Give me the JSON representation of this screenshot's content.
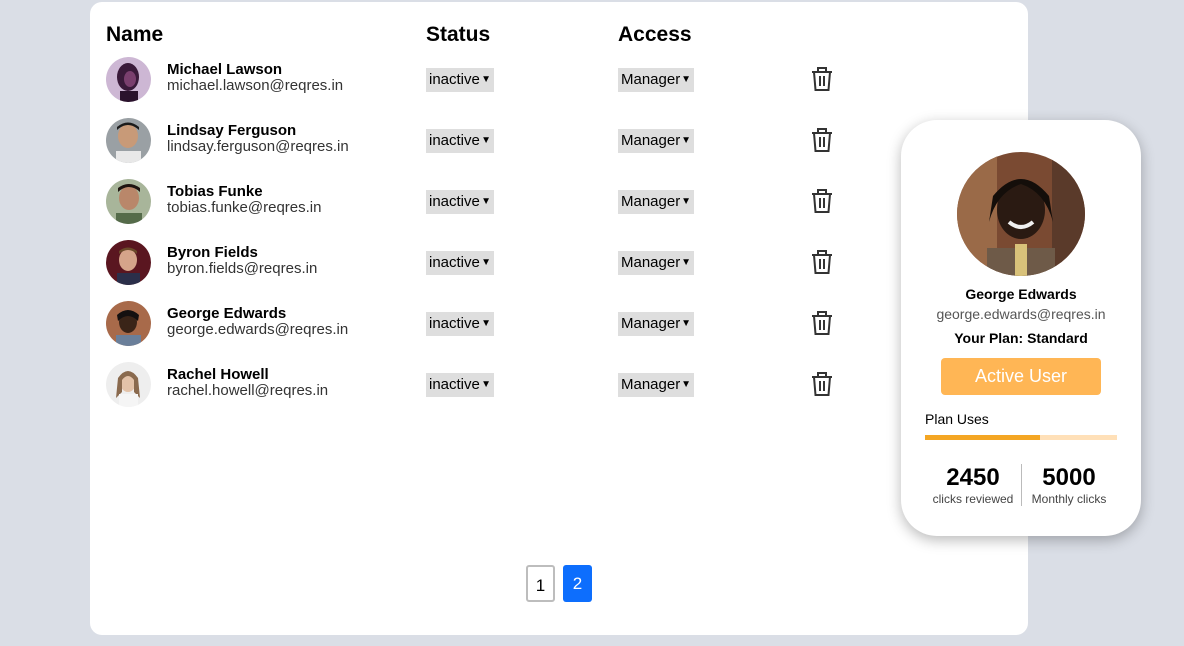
{
  "table": {
    "headers": {
      "name": "Name",
      "status": "Status",
      "access": "Access"
    },
    "rows": [
      {
        "name": "Michael Lawson",
        "email": "michael.lawson@reqres.in",
        "status": "inactive",
        "access": "Manager"
      },
      {
        "name": "Lindsay Ferguson",
        "email": "lindsay.ferguson@reqres.in",
        "status": "inactive",
        "access": "Manager"
      },
      {
        "name": "Tobias Funke",
        "email": "tobias.funke@reqres.in",
        "status": "inactive",
        "access": "Manager"
      },
      {
        "name": "Byron Fields",
        "email": "byron.fields@reqres.in",
        "status": "inactive",
        "access": "Manager"
      },
      {
        "name": "George Edwards",
        "email": "george.edwards@reqres.in",
        "status": "inactive",
        "access": "Manager"
      },
      {
        "name": "Rachel Howell",
        "email": "rachel.howell@reqres.in",
        "status": "inactive",
        "access": "Manager"
      }
    ]
  },
  "pagination": {
    "pages": [
      "1",
      "2"
    ],
    "current": "2"
  },
  "profile": {
    "name": "George Edwards",
    "email": "george.edwards@reqres.in",
    "plan": "Your Plan: Standard",
    "button": "Active User",
    "uses_label": "Plan Uses",
    "uses_fraction": 0.6,
    "stats": [
      {
        "value": "2450",
        "label": "clicks reviewed"
      },
      {
        "value": "5000",
        "label": "Monthly clicks"
      }
    ]
  },
  "colors": {
    "background": "#dadee6",
    "accent_blue": "#0d6efd",
    "button_orange": "#ffb655",
    "bar_fill": "#f4a623",
    "bar_track": "#ffe0b8"
  },
  "icons": {
    "delete": "trash-icon",
    "dropdown": "chevron-down-icon"
  }
}
